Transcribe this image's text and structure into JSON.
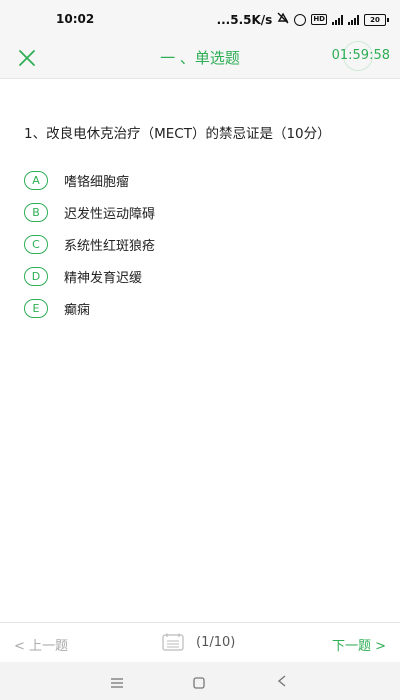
{
  "status_bar": {
    "time": "10:02",
    "network_speed": "...5.5K/s",
    "hd_label": "HD",
    "battery_level": "20"
  },
  "header": {
    "title": "一 、单选题",
    "timer": "01:59:58",
    "accent_color": "#2eae55"
  },
  "question": {
    "text": "1、改良电休克治疗（MECT）的禁忌证是（10分）",
    "options": [
      {
        "letter": "A",
        "text": "嗜铬细胞瘤"
      },
      {
        "letter": "B",
        "text": "迟发性运动障碍"
      },
      {
        "letter": "C",
        "text": "系统性红斑狼疮"
      },
      {
        "letter": "D",
        "text": "精神发育迟缓"
      },
      {
        "letter": "E",
        "text": "癫痫"
      }
    ]
  },
  "footer": {
    "prev_label": "< 上一题",
    "progress": "(1/10)",
    "next_label": "下一题 >"
  },
  "icons": {
    "close": "close-icon",
    "answer_sheet": "answer-sheet-icon",
    "nav_menu": "menu-icon",
    "nav_home": "home-icon",
    "nav_back": "back-icon"
  }
}
